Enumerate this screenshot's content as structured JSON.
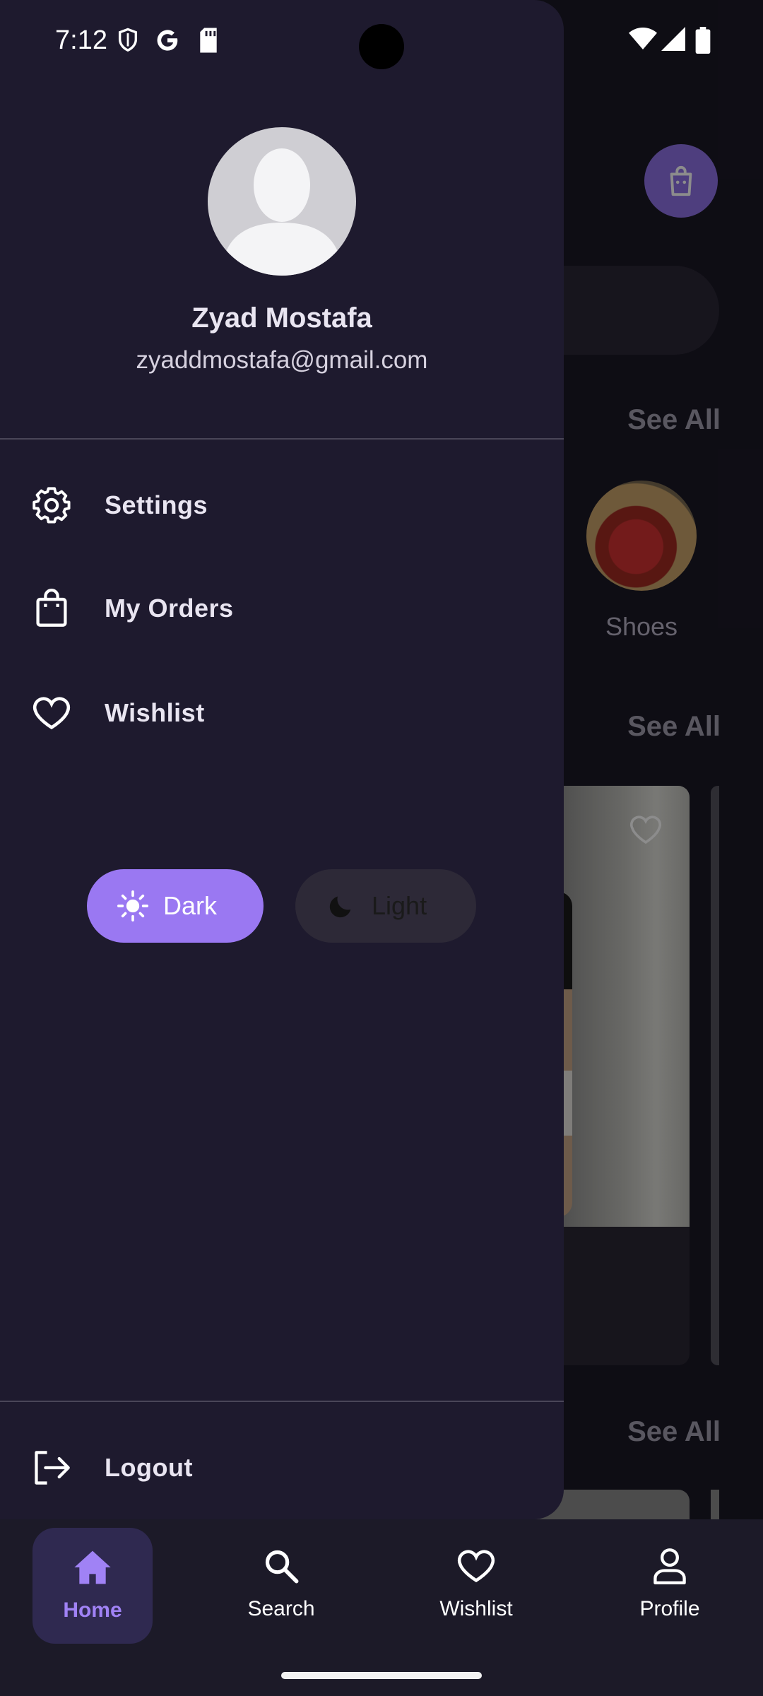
{
  "status_bar": {
    "time": "7:12",
    "icons": [
      "shield-icon",
      "google-icon",
      "sd-card-icon",
      "wifi-icon",
      "signal-icon",
      "battery-icon"
    ]
  },
  "background": {
    "see_all_labels": [
      "See All",
      "See All",
      "See All"
    ],
    "category_label": "Shoes"
  },
  "drawer": {
    "user": {
      "name": "Zyad Mostafa",
      "email": "zyaddmostafa@gmail.com"
    },
    "menu": [
      {
        "label": "Settings",
        "icon": "gear-icon"
      },
      {
        "label": "My Orders",
        "icon": "shopping-bag-icon"
      },
      {
        "label": "Wishlist",
        "icon": "heart-icon"
      }
    ],
    "theme": {
      "dark_label": "Dark",
      "light_label": "Light",
      "selected": "Dark"
    },
    "logout_label": "Logout"
  },
  "bottom_nav": {
    "items": [
      {
        "label": "Home",
        "icon": "home-icon",
        "active": true
      },
      {
        "label": "Search",
        "icon": "search-icon",
        "active": false
      },
      {
        "label": "Wishlist",
        "icon": "heart-icon",
        "active": false
      },
      {
        "label": "Profile",
        "icon": "person-icon",
        "active": false
      }
    ]
  },
  "colors": {
    "accent": "#9a78f2",
    "drawer_bg": "#1e1a2e",
    "nav_active_bg": "#2f2950"
  }
}
